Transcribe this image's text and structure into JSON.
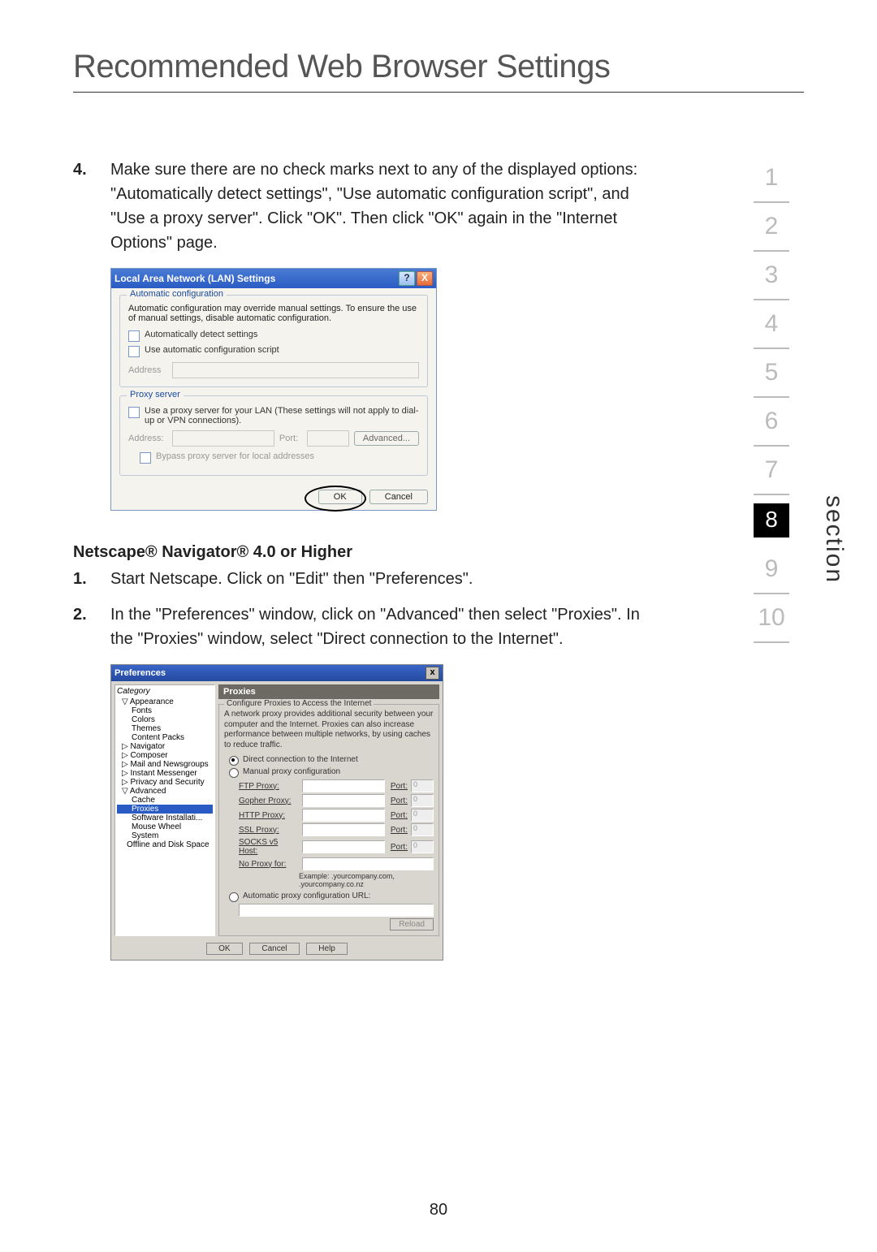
{
  "title": "Recommended Web Browser Settings",
  "page_number": "80",
  "side_label": "section",
  "nav": [
    "1",
    "2",
    "3",
    "4",
    "5",
    "6",
    "7",
    "8",
    "9",
    "10"
  ],
  "nav_current_index": 7,
  "step4": {
    "num": "4.",
    "text": "Make sure there are no check marks next to any of the displayed options: \"Automatically detect settings\", \"Use automatic configuration script\", and \"Use a proxy server\". Click \"OK\". Then click \"OK\" again in the \"Internet Options\" page."
  },
  "lan": {
    "title": "Local Area Network (LAN) Settings",
    "help": "?",
    "close": "X",
    "grp1_legend": "Automatic configuration",
    "grp1_text": "Automatic configuration may override manual settings. To ensure the use of manual settings, disable automatic configuration.",
    "ck1": "Automatically detect settings",
    "ck2": "Use automatic configuration script",
    "addr_label": "Address",
    "grp2_legend": "Proxy server",
    "ck3": "Use a proxy server for your LAN (These settings will not apply to dial-up or VPN connections).",
    "addr2_label": "Address:",
    "port_label": "Port:",
    "advanced": "Advanced...",
    "ck4": "Bypass proxy server for local addresses",
    "ok": "OK",
    "cancel": "Cancel"
  },
  "netscape_heading": "Netscape® Navigator® 4.0 or Higher",
  "ns_step1": {
    "num": "1.",
    "text": "Start Netscape. Click on \"Edit\" then \"Preferences\"."
  },
  "ns_step2": {
    "num": "2.",
    "text": "In the \"Preferences\" window, click on \"Advanced\" then select \"Proxies\". In the \"Proxies\" window, select \"Direct connection to the Internet\"."
  },
  "pref": {
    "title": "Preferences",
    "close": "x",
    "cat_label": "Category",
    "tree": {
      "appearance": "Appearance",
      "fonts": "Fonts",
      "colors": "Colors",
      "themes": "Themes",
      "content": "Content Packs",
      "navigator": "Navigator",
      "composer": "Composer",
      "mail": "Mail and Newsgroups",
      "im": "Instant Messenger",
      "privacy": "Privacy and Security",
      "advanced": "Advanced",
      "cache": "Cache",
      "proxies": "Proxies",
      "software": "Software Installati...",
      "mouse": "Mouse Wheel",
      "system": "System",
      "offline": "Offline and Disk Space"
    },
    "pane_title": "Proxies",
    "fset_legend": "Configure Proxies to Access the Internet",
    "fset_desc": "A network proxy provides additional security between your computer and the Internet. Proxies can also increase performance between multiple networks, by using caches to reduce traffic.",
    "r_direct": "Direct connection to the Internet",
    "r_manual": "Manual proxy configuration",
    "rows": {
      "ftp": "FTP Proxy:",
      "gopher": "Gopher Proxy:",
      "http": "HTTP Proxy:",
      "ssl": "SSL Proxy:",
      "socks": "SOCKS v5 Host:",
      "noproxy": "No Proxy for:"
    },
    "port": "Port:",
    "portval": "0",
    "example": "Example: .yourcompany.com, .yourcompany.co.nz",
    "r_auto": "Automatic proxy configuration URL:",
    "reload": "Reload",
    "ok": "OK",
    "cancel": "Cancel",
    "help": "Help"
  }
}
